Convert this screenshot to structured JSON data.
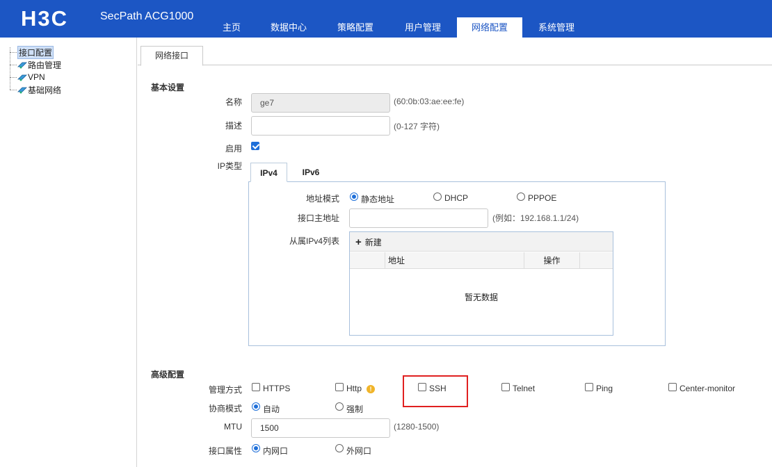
{
  "header": {
    "product": "SecPath ACG1000",
    "brand_color": "#1c56c4",
    "nav": [
      "主页",
      "数据中心",
      "策略配置",
      "用户管理",
      "网络配置",
      "系统管理"
    ],
    "active_nav": "网络配置"
  },
  "sidebar": {
    "items": [
      {
        "label": "接口配置",
        "selected": true
      },
      {
        "label": "路由管理",
        "icon": "network-icon"
      },
      {
        "label": "VPN",
        "icon": "network-icon"
      },
      {
        "label": "基础网络",
        "icon": "network-icon"
      }
    ]
  },
  "page_tab": "网络接口",
  "basic": {
    "title": "基本设置",
    "name_label": "名称",
    "name_value": "ge7",
    "name_hint": "(60:0b:03:ae:ee:fe)",
    "desc_label": "描述",
    "desc_value": "",
    "desc_hint": "(0-127 字符)",
    "enable_label": "启用",
    "enable_checked": true,
    "iptype_label": "IP类型",
    "ip_tabs": [
      "IPv4",
      "IPv6"
    ],
    "active_ip_tab": "IPv4"
  },
  "ipv4": {
    "mode_label": "地址模式",
    "modes": [
      "静态地址",
      "DHCP",
      "PPPOE"
    ],
    "selected_mode": "静态地址",
    "primary_label": "接口主地址",
    "primary_value": "",
    "primary_hint": "(例如：192.168.1.1/24)",
    "secondary_label": "从属IPv4列表",
    "new_button": "新建",
    "columns": [
      "地址",
      "操作"
    ],
    "empty_text": "暂无数据"
  },
  "advanced": {
    "title": "高级配置",
    "mgmt_label": "管理方式",
    "mgmt_options": [
      {
        "label": "HTTPS",
        "checked": false
      },
      {
        "label": "Http",
        "checked": false
      },
      {
        "label": "SSH",
        "checked": false
      },
      {
        "label": "Telnet",
        "checked": false
      },
      {
        "label": "Ping",
        "checked": false
      },
      {
        "label": "Center-monitor",
        "checked": false
      }
    ],
    "negotiation_label": "协商模式",
    "negotiation_options": [
      "自动",
      "强制"
    ],
    "negotiation_selected": "自动",
    "mtu_label": "MTU",
    "mtu_value": "1500",
    "mtu_hint": "(1280-1500)",
    "iface_attr_label": "接口属性",
    "iface_attr_options": [
      "内网口",
      "外网口"
    ],
    "iface_attr_selected": "内网口"
  }
}
